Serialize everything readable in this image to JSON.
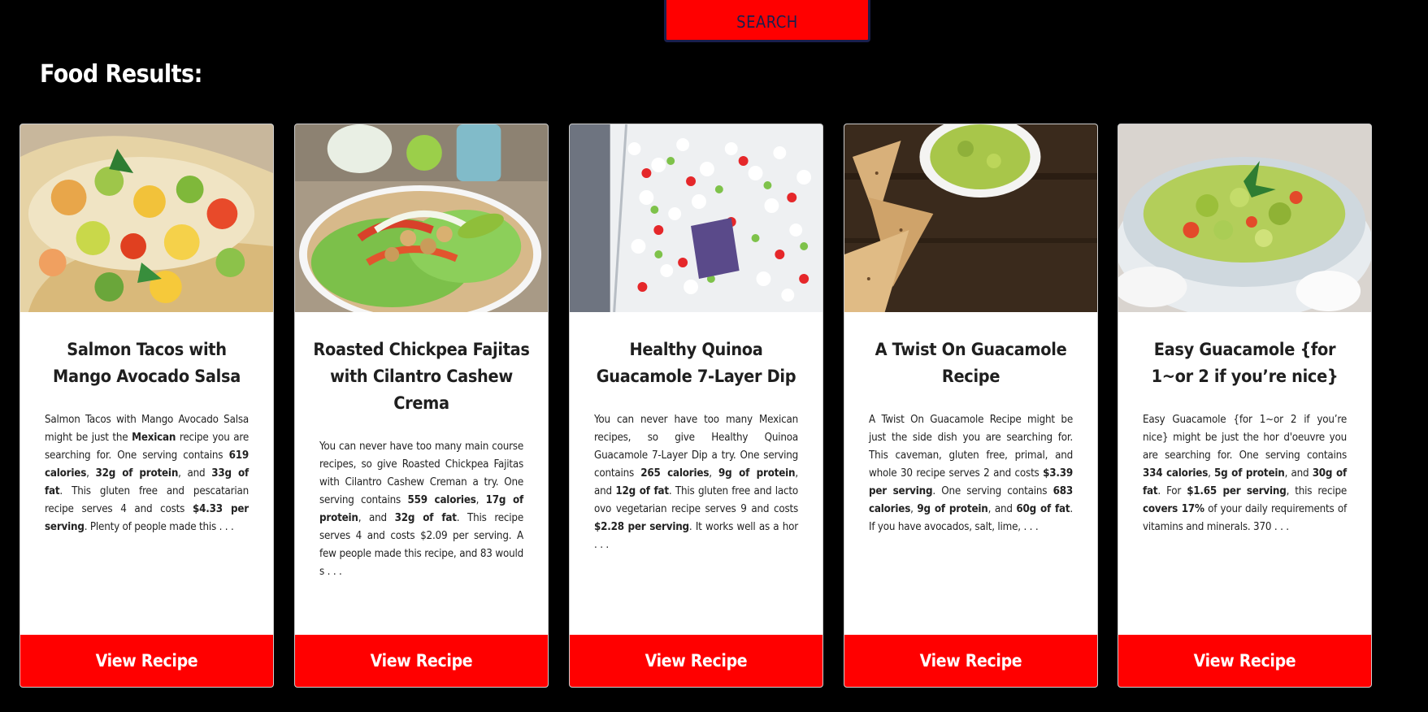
{
  "search": {
    "label": "SEARCH"
  },
  "results_title": "Food Results:",
  "colors": {
    "accent": "#ff0000",
    "background": "#000000",
    "card": "#ffffff"
  },
  "cards": [
    {
      "title": "Salmon Tacos with Mango Avocado Salsa",
      "image": "salmon-tacos-photo",
      "desc": [
        {
          "t": "Salmon Tacos with Mango Avocado Salsa might be just the "
        },
        {
          "t": "Mexican",
          "b": true
        },
        {
          "t": " recipe you are searching for. One serving contains "
        },
        {
          "t": "619 calories",
          "b": true
        },
        {
          "t": ", "
        },
        {
          "t": "32g of protein",
          "b": true
        },
        {
          "t": ", and "
        },
        {
          "t": "33g of fat",
          "b": true
        },
        {
          "t": ". This gluten free and pescatarian recipe serves 4 and costs "
        },
        {
          "t": "$4.33 per serving",
          "b": true
        },
        {
          "t": ". Plenty of people made this . . ."
        }
      ],
      "button": "View Recipe"
    },
    {
      "title": "Roasted Chickpea Fajitas with Cilantro Cashew Crema",
      "image": "chickpea-fajitas-photo",
      "desc": [
        {
          "t": "You can never have too many main course recipes, so give Roasted Chickpea Fajitas with Cilantro Cashew Creman a try. One serving contains "
        },
        {
          "t": "559 calories",
          "b": true
        },
        {
          "t": ", "
        },
        {
          "t": "17g of protein",
          "b": true
        },
        {
          "t": ", and "
        },
        {
          "t": "32g of fat",
          "b": true
        },
        {
          "t": ". This recipe serves 4 and costs $2.09 per serving. A few people made this recipe, and 83 would s . . ."
        }
      ],
      "button": "View Recipe"
    },
    {
      "title": "Healthy Quinoa Guacamole 7-Layer Dip",
      "image": "quinoa-dip-photo",
      "desc": [
        {
          "t": "You can never have too many Mexican recipes, so give Healthy Quinoa Guacamole 7-Layer Dip a try. One serving contains "
        },
        {
          "t": "265 calories",
          "b": true
        },
        {
          "t": ", "
        },
        {
          "t": "9g of protein",
          "b": true
        },
        {
          "t": ", and "
        },
        {
          "t": "12g of fat",
          "b": true
        },
        {
          "t": ". This gluten free and lacto ovo vegetarian recipe serves 9 and costs "
        },
        {
          "t": "$2.28 per serving",
          "b": true
        },
        {
          "t": ". It works well as a hor . . ."
        }
      ],
      "button": "View Recipe"
    },
    {
      "title": "A Twist On Guacamole Recipe",
      "image": "guacamole-chips-photo",
      "desc": [
        {
          "t": "A Twist On Guacamole Recipe might be just the side dish you are searching for. This caveman, gluten free, primal, and whole 30 recipe serves 2 and costs "
        },
        {
          "t": "$3.39 per serving",
          "b": true
        },
        {
          "t": ". One serving contains "
        },
        {
          "t": "683 calories",
          "b": true
        },
        {
          "t": ", "
        },
        {
          "t": "9g of protein",
          "b": true
        },
        {
          "t": ", and "
        },
        {
          "t": "60g of fat",
          "b": true
        },
        {
          "t": ". If you have avocados, salt, lime, . . ."
        }
      ],
      "button": "View Recipe"
    },
    {
      "title": "Easy Guacamole {for 1~or 2 if you’re nice}",
      "image": "guacamole-bowl-photo",
      "desc": [
        {
          "t": "Easy Guacamole {for 1~or 2 if you’re nice} might be just the hor d'oeuvre you are searching for. One serving contains "
        },
        {
          "t": "334 calories",
          "b": true
        },
        {
          "t": ", "
        },
        {
          "t": "5g of protein",
          "b": true
        },
        {
          "t": ", and "
        },
        {
          "t": "30g of fat",
          "b": true
        },
        {
          "t": ". For "
        },
        {
          "t": "$1.65 per serving",
          "b": true
        },
        {
          "t": ", this recipe "
        },
        {
          "t": "covers 17%",
          "b": true
        },
        {
          "t": " of your daily requirements of vitamins and minerals. 370 . . ."
        }
      ],
      "button": "View Recipe"
    }
  ]
}
